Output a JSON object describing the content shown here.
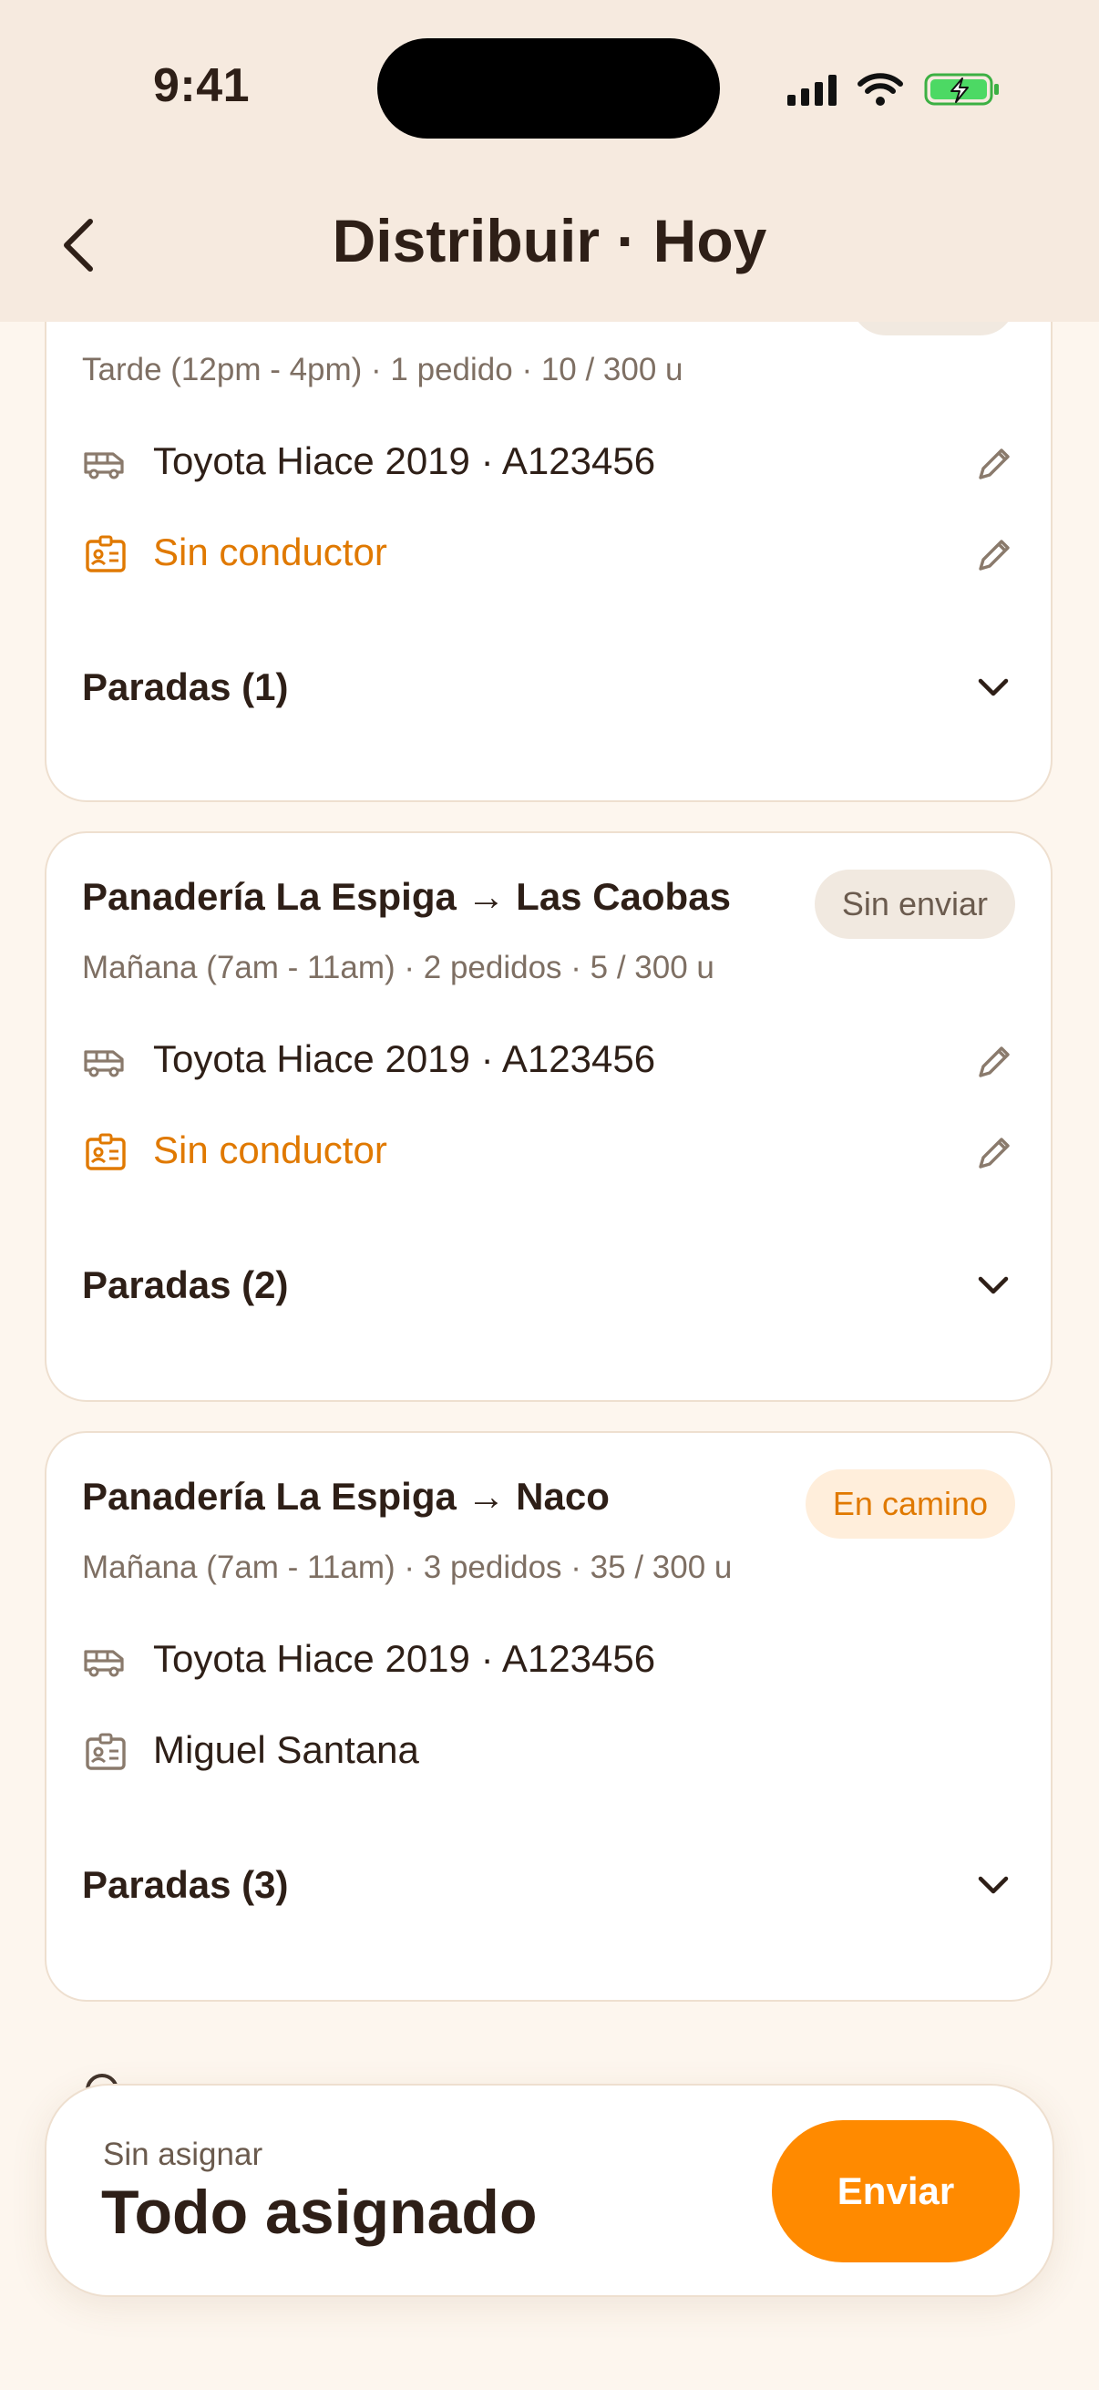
{
  "status_bar": {
    "time": "9:41"
  },
  "header": {
    "title": "Distribuir · Hoy"
  },
  "routes": [
    {
      "title": "",
      "subtitle": "Tarde (12pm - 4pm) · 1 pedido · 10 / 300 u",
      "vehicle": "Toyota Hiace 2019 · A123456",
      "driver": "Sin conductor",
      "stops_label": "Paradas (1)"
    },
    {
      "title": "Panadería La Espiga → Las Caobas",
      "status": "Sin enviar",
      "subtitle": "Mañana (7am - 11am) · 2 pedidos · 5 / 300 u",
      "vehicle": "Toyota Hiace 2019 · A123456",
      "driver": "Sin conductor",
      "stops_label": "Paradas (2)"
    },
    {
      "title": "Panadería La Espiga → Naco",
      "status": "En camino",
      "subtitle": "Mañana (7am - 11am) · 3 pedidos · 35 / 300 u",
      "vehicle": "Toyota Hiace 2019 · A123456",
      "driver": "Miguel Santana",
      "stops_label": "Paradas (3)"
    }
  ],
  "footer": {
    "label": "Sin asignar",
    "value": "Todo asignado",
    "send_label": "Enviar"
  },
  "colors": {
    "accent": "#FF8A00",
    "warning_text": "#E07900",
    "background": "#FDF6EE",
    "header_bg": "#F6EADF"
  }
}
